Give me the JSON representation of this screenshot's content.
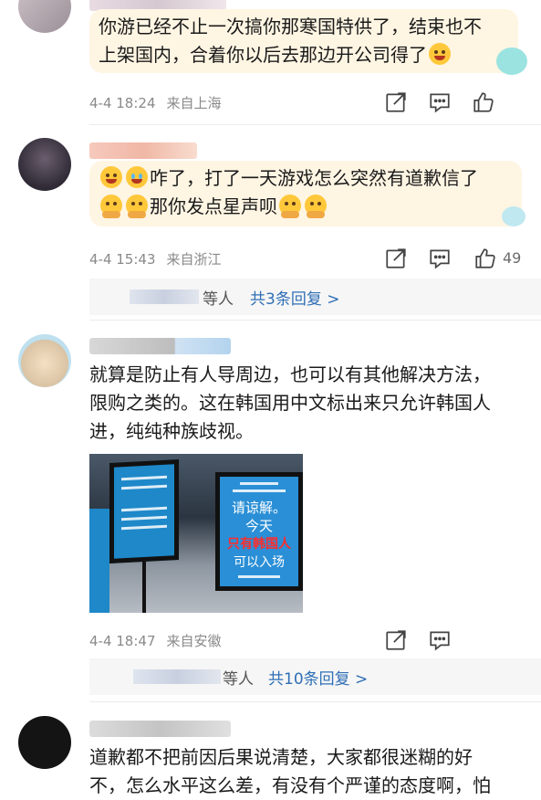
{
  "comments": [
    {
      "text_line1": "你游已经不止一次搞你那寒国特供了，结束也不",
      "text_line2": "上架国内，合着你以后去那边开公司得了",
      "date": "4-4 18:24",
      "location": "来自上海"
    },
    {
      "text_line1": "咋了，打了一天游戏怎么突然有道歉信了",
      "text_line2": "那你发点星声呗",
      "date": "4-4 15:43",
      "location": "来自浙江",
      "likes": "49",
      "replies_prefix": "等人",
      "replies_link": "共3条回复 >"
    },
    {
      "text_line1": "就算是防止有人导周边，也可以有其他解决方法，",
      "text_line2": "限购之类的。这在韩国用中文标出来只允许韩国人",
      "text_line3": "进，纯纯种族歧视。",
      "photo_sign_lines": [
        "请谅解。",
        "今天",
        "只有韩国人",
        "可以入场"
      ],
      "date": "4-4 18:47",
      "location": "来自安徽",
      "replies_prefix": "等人",
      "replies_link": "共10条回复 >"
    },
    {
      "text_line1": "道歉都不把前因后果说清楚，大家都很迷糊的好",
      "text_line2": "不，怎么水平这么差，有没有个严谨的态度啊，怕"
    }
  ],
  "icons": [
    "share-icon",
    "comment-icon",
    "like-icon"
  ],
  "colors": {
    "bubble": "#fff5e3",
    "link": "#2f6fb5",
    "meta": "#8a8a8a"
  }
}
